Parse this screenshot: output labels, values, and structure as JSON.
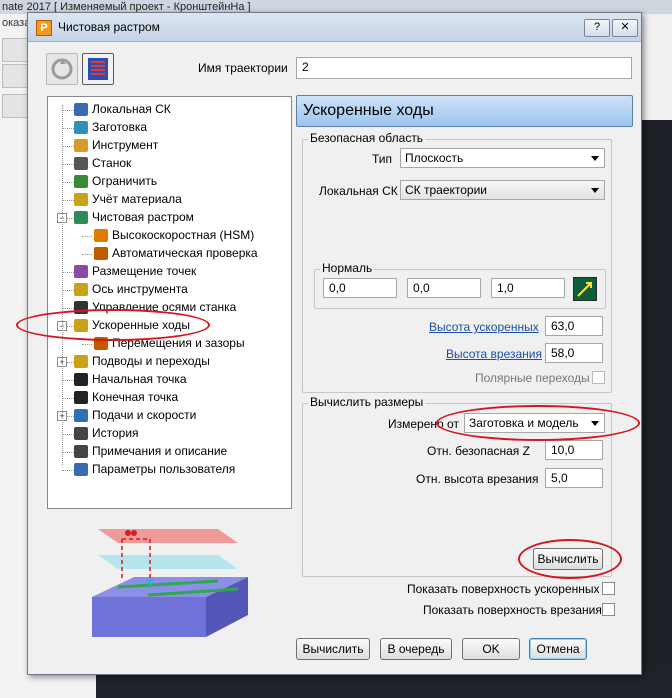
{
  "background": {
    "title_fragment": "nate 2017  [ Изменяемый проект - КронштейнНа ]",
    "left_label": "оказа"
  },
  "dialog": {
    "title": "Чистовая растром",
    "help_glyph": "?",
    "close_glyph": "✕",
    "trajectory_name_label": "Имя траектории",
    "trajectory_name_value": "2"
  },
  "tree": {
    "items": [
      {
        "label": "Локальная СК",
        "icon": "local-cs-icon",
        "color": "#3a6ab0"
      },
      {
        "label": "Заготовка",
        "icon": "stock-icon",
        "color": "#2f8fb8"
      },
      {
        "label": "Инструмент",
        "icon": "tool-icon",
        "color": "#d89a2a"
      },
      {
        "label": "Станок",
        "icon": "machine-icon",
        "color": "#555555"
      },
      {
        "label": "Ограничить",
        "icon": "limit-icon",
        "color": "#3a8a3a"
      },
      {
        "label": "Учёт материала",
        "icon": "material-icon",
        "color": "#c9a21a"
      },
      {
        "label": "Чистовая растром",
        "icon": "raster-finish-icon",
        "color": "#2e8b57"
      },
      {
        "label": "Высокоскоростная (HSM)",
        "icon": "hsm-icon",
        "color": "#e07b00"
      },
      {
        "label": "Автоматическая проверка",
        "icon": "auto-check-icon",
        "color": "#c05a00"
      },
      {
        "label": "Размещение точек",
        "icon": "point-distribution-icon",
        "color": "#8a4aa8"
      },
      {
        "label": "Ось инструмента",
        "icon": "tool-axis-icon",
        "color": "#c9a21a"
      },
      {
        "label": "Управление осями станка",
        "icon": "axis-control-icon",
        "color": "#333333"
      },
      {
        "label": "Ускоренные ходы",
        "icon": "rapid-moves-icon",
        "color": "#c9a21a"
      },
      {
        "label": "Перемещения и зазоры",
        "icon": "moves-clearances-icon",
        "color": "#c05a00"
      },
      {
        "label": "Подводы и переходы",
        "icon": "leads-links-icon",
        "color": "#c9a21a"
      },
      {
        "label": "Начальная точка",
        "icon": "start-point-icon",
        "color": "#222222"
      },
      {
        "label": "Конечная точка",
        "icon": "end-point-icon",
        "color": "#222222"
      },
      {
        "label": "Подачи и скорости",
        "icon": "feeds-speeds-icon",
        "color": "#2f6fb8"
      },
      {
        "label": "История",
        "icon": "history-icon",
        "color": "#444444"
      },
      {
        "label": "Примечания и описание",
        "icon": "notes-icon",
        "color": "#444444"
      },
      {
        "label": "Параметры пользователя",
        "icon": "user-params-icon",
        "color": "#3a6ab0"
      }
    ]
  },
  "panel": {
    "header": "Ускоренные ходы",
    "safe_area": {
      "title": "Безопасная область",
      "type_label": "Тип",
      "type_value": "Плоскость",
      "local_cs_label": "Локальная СК",
      "local_cs_value": "СК траектории",
      "normal": {
        "title": "Нормаль",
        "x": "0,0",
        "y": "0,0",
        "z": "1,0"
      },
      "rapid_height_label": "Высота ускоренных",
      "rapid_height_value": "63,0",
      "plunge_height_label": "Высота врезания",
      "plunge_height_value": "58,0",
      "polar_moves_label": "Полярные переходы"
    },
    "calc_dims": {
      "title": "Вычислить размеры",
      "measured_from_label": "Измерено от",
      "measured_from_value": "Заготовка и модель",
      "rel_safe_z_label": "Отн. безопасная Z",
      "rel_safe_z_value": "10,0",
      "rel_plunge_label": "Отн. высота врезания",
      "rel_plunge_value": "5,0",
      "calculate_button": "Вычислить"
    },
    "show_rapid_surface_label": "Показать поверхность ускоренных",
    "show_plunge_surface_label": "Показать поверхность врезания"
  },
  "footer": {
    "calculate": "Вычислить",
    "queue": "В очередь",
    "ok": "OK",
    "cancel": "Отмена"
  },
  "colors": {
    "annotation_red": "#d8141e",
    "header_blue": "#9cc4ee",
    "link_blue": "#1a4fa8"
  }
}
